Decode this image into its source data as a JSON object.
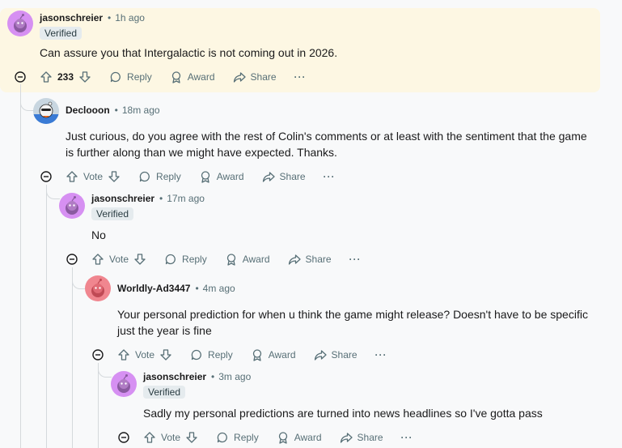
{
  "labels": {
    "reply": "Reply",
    "award": "Award",
    "share": "Share",
    "more": "···",
    "separator": "•"
  },
  "comments": [
    {
      "author": "jasonschreier",
      "time": "1h ago",
      "badge": "Verified",
      "avatar_color": "#d690f2",
      "body": [
        "Can assure you that Intergalactic is not coming out in 2026."
      ],
      "vote": "233"
    },
    {
      "author": "Declooon",
      "time": "18m ago",
      "badge": "",
      "avatar_color": "#3a7bd5",
      "body": [
        "Just curious, do you agree with the rest of Colin's comments or at least with the sentiment that the game",
        "is further along than we might have expected. Thanks."
      ],
      "vote": "Vote"
    },
    {
      "author": "jasonschreier",
      "time": "17m ago",
      "badge": "Verified",
      "avatar_color": "#d690f2",
      "body": [
        "No"
      ],
      "vote": "Vote"
    },
    {
      "author": "Worldly-Ad3447",
      "time": "4m ago",
      "badge": "",
      "avatar_color": "#f0868f",
      "body": [
        "Your personal prediction for when u think the game might release? Doesn't have to be specific",
        "just the year is fine"
      ],
      "vote": "Vote"
    },
    {
      "author": "jasonschreier",
      "time": "3m ago",
      "badge": "Verified",
      "avatar_color": "#d690f2",
      "body": [
        "Sadly my personal predictions are turned into news headlines so I've gotta pass"
      ],
      "vote": "Vote"
    }
  ],
  "colors": {
    "highlight": "#fdf7e3",
    "thread_line": "#d5d9dc",
    "badge_bg": "#e5ebee",
    "meta": "#576f76"
  }
}
